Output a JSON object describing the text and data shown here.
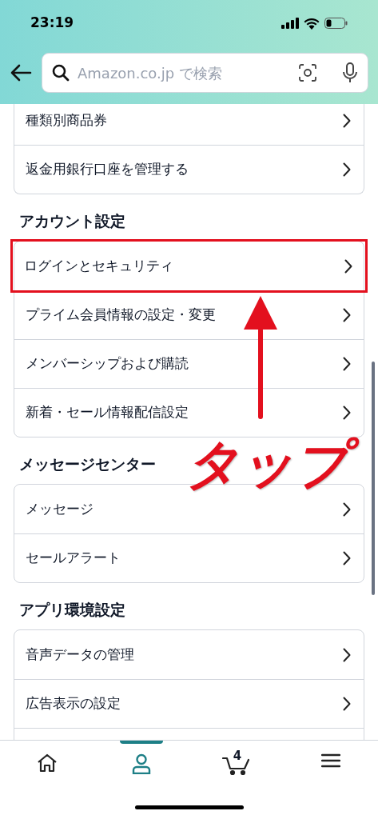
{
  "status_bar": {
    "time": "23:19"
  },
  "search": {
    "placeholder": "Amazon.co.jp で検索"
  },
  "sections": [
    {
      "items": [
        {
          "label": "種類別商品券",
          "highlighted": false
        },
        {
          "label": "返金用銀行口座を管理する",
          "highlighted": false
        }
      ]
    },
    {
      "heading": "アカウント設定",
      "items": [
        {
          "label": "ログインとセキュリティ",
          "highlighted": true
        },
        {
          "label": "プライム会員情報の設定・変更",
          "highlighted": false
        },
        {
          "label": "メンバーシップおよび購読",
          "highlighted": false
        },
        {
          "label": "新着・セール情報配信設定",
          "highlighted": false
        }
      ]
    },
    {
      "heading": "メッセージセンター",
      "items": [
        {
          "label": "メッセージ",
          "highlighted": false
        },
        {
          "label": "セールアラート",
          "highlighted": false
        }
      ]
    },
    {
      "heading": "アプリ環境設定",
      "items": [
        {
          "label": "音声データの管理",
          "highlighted": false
        },
        {
          "label": "広告表示の設定",
          "highlighted": false
        }
      ]
    }
  ],
  "bottom_nav": [
    {
      "kind": "home",
      "selected": false
    },
    {
      "kind": "account",
      "selected": true
    },
    {
      "kind": "cart",
      "badge": "4",
      "selected": false
    },
    {
      "kind": "menu",
      "selected": false
    }
  ],
  "annotation": {
    "label": "タップ"
  }
}
